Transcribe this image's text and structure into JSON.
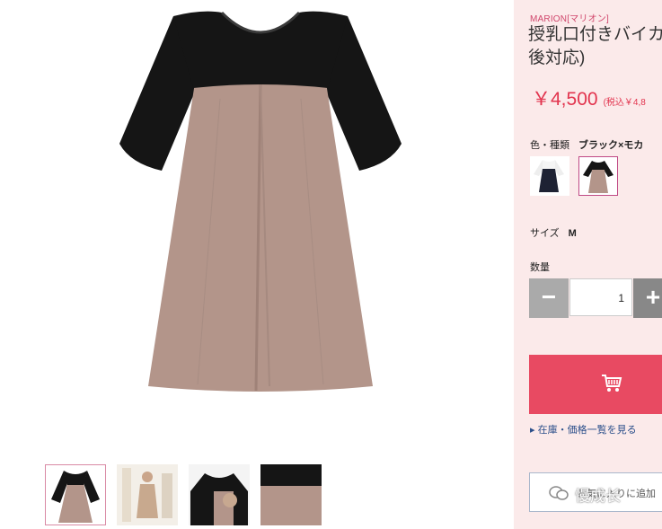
{
  "product": {
    "brand": "MARION[マリオン]",
    "title_line1": "授乳口付きバイカ",
    "title_line2": "後対応)",
    "price": "￥4,500",
    "price_tax": "(税込￥4,8"
  },
  "options": {
    "color_label": "色・種類",
    "color_value": "ブラック×モカ",
    "size_label": "サイズ",
    "size_value": "M",
    "qty_label": "数量",
    "qty_value": "1",
    "minus": "−",
    "plus": "+"
  },
  "links": {
    "stock_link": "在庫・価格一覧を見る",
    "favorite": "お気に入りに追加"
  },
  "watermark": "慢成长",
  "colors": {
    "accent": "#e84a62",
    "brand": "#d0456b",
    "panel_bg": "#fbeaea",
    "dress_black": "#151515",
    "dress_mocha": "#b3958a"
  }
}
